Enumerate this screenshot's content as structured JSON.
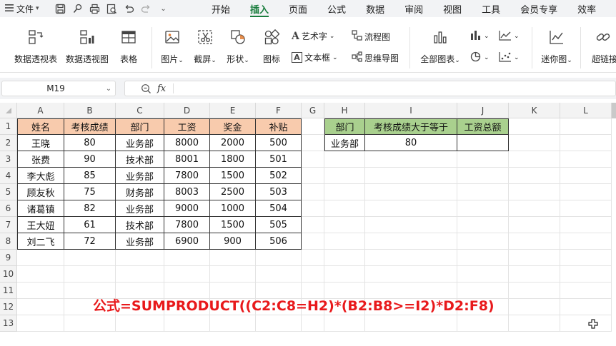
{
  "menubar": {
    "file_label": "文件",
    "tabs": [
      {
        "label": "开始",
        "active": false
      },
      {
        "label": "插入",
        "active": true
      },
      {
        "label": "页面",
        "active": false
      },
      {
        "label": "公式",
        "active": false
      },
      {
        "label": "数据",
        "active": false
      },
      {
        "label": "审阅",
        "active": false
      },
      {
        "label": "视图",
        "active": false
      },
      {
        "label": "工具",
        "active": false
      },
      {
        "label": "会员专享",
        "active": false
      },
      {
        "label": "效率",
        "active": false
      }
    ]
  },
  "ribbon": {
    "pivot_table": "数据透视表",
    "pivot_chart": "数据透视图",
    "table": "表格",
    "picture": "图片",
    "screenshot": "截屏",
    "shapes": "形状",
    "icons": "图标",
    "wordart": "艺术字",
    "textbox": "文本框",
    "flowchart": "流程图",
    "mindmap": "思维导图",
    "all_charts": "全部图表",
    "sparkline": "迷你图",
    "hyperlink": "超链接"
  },
  "formula_bar": {
    "name_box": "M19",
    "fx_label": "fx",
    "value": ""
  },
  "columns": [
    "A",
    "B",
    "C",
    "D",
    "E",
    "F",
    "G",
    "H",
    "I",
    "J",
    "K",
    "L"
  ],
  "rows": [
    "1",
    "2",
    "3",
    "4",
    "5",
    "6",
    "7",
    "8",
    "9",
    "10",
    "11",
    "12",
    "13"
  ],
  "table1": {
    "headers": [
      "姓名",
      "考核成绩",
      "部门",
      "工资",
      "奖金",
      "补贴"
    ],
    "rows": [
      [
        "王晓",
        "80",
        "业务部",
        "8000",
        "2000",
        "500"
      ],
      [
        "张费",
        "90",
        "技术部",
        "8001",
        "1800",
        "501"
      ],
      [
        "李大彪",
        "85",
        "业务部",
        "7800",
        "1500",
        "502"
      ],
      [
        "顾友秋",
        "75",
        "财务部",
        "8003",
        "2500",
        "503"
      ],
      [
        "诸葛镇",
        "82",
        "业务部",
        "9000",
        "1000",
        "504"
      ],
      [
        "王大妞",
        "61",
        "技术部",
        "7800",
        "1500",
        "505"
      ],
      [
        "刘二飞",
        "72",
        "业务部",
        "6900",
        "900",
        "506"
      ]
    ]
  },
  "table2": {
    "headers": [
      "部门",
      "考核成绩大于等于",
      "工资总额"
    ],
    "row": [
      "业务部",
      "80",
      ""
    ]
  },
  "note": "公式=SUMPRODUCT((C2:C8=H2)*(B2:B8>=I2)*D2:F8)",
  "colors": {
    "accent": "#1a7d3d",
    "header_orange": "#f8cbad",
    "header_green": "#a9d08e",
    "note_red": "#e8191b"
  }
}
